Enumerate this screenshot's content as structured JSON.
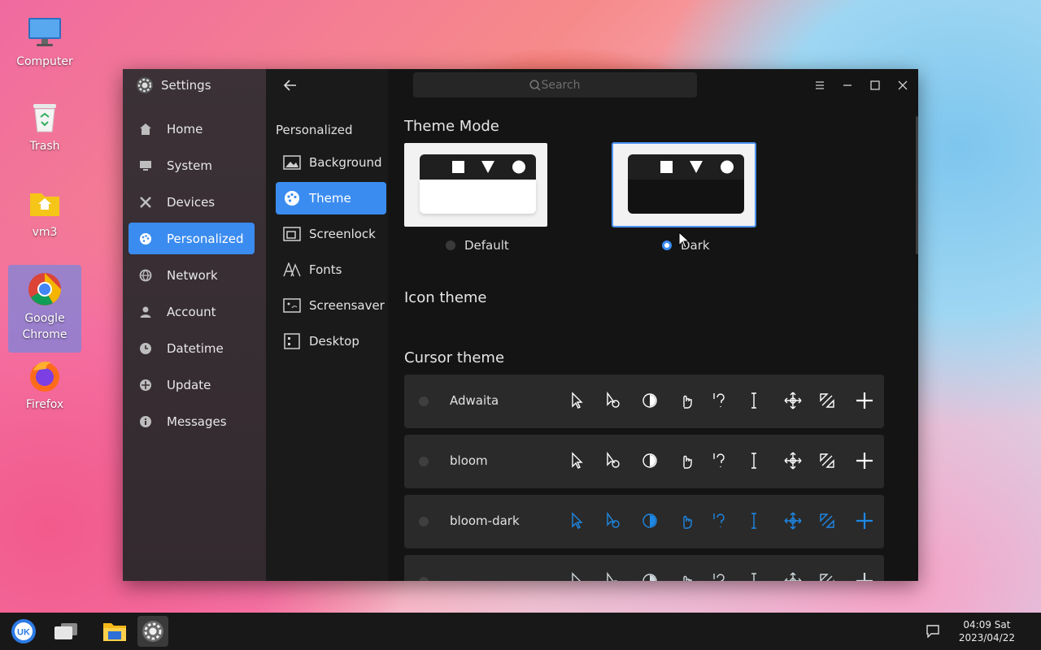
{
  "desktop": {
    "icons": [
      {
        "label": "Computer"
      },
      {
        "label": "Trash"
      },
      {
        "label": "vm3"
      },
      {
        "label": "Google\nChrome"
      },
      {
        "label": "Firefox"
      }
    ]
  },
  "window": {
    "app_title": "Settings",
    "search_placeholder": "Search",
    "sidebar": [
      {
        "label": "Home",
        "icon": "home-icon"
      },
      {
        "label": "System",
        "icon": "monitor-icon"
      },
      {
        "label": "Devices",
        "icon": "tools-icon"
      },
      {
        "label": "Personalized",
        "icon": "palette-icon",
        "active": true
      },
      {
        "label": "Network",
        "icon": "globe-icon"
      },
      {
        "label": "Account",
        "icon": "user-icon"
      },
      {
        "label": "Datetime",
        "icon": "clock-icon"
      },
      {
        "label": "Update",
        "icon": "update-icon"
      },
      {
        "label": "Messages",
        "icon": "info-icon"
      }
    ],
    "subnav": {
      "header": "Personalized",
      "items": [
        {
          "label": "Background",
          "icon": "image-icon"
        },
        {
          "label": "Theme",
          "icon": "palette-icon",
          "active": true
        },
        {
          "label": "Screenlock",
          "icon": "screenlock-icon"
        },
        {
          "label": "Fonts",
          "icon": "font-icon"
        },
        {
          "label": "Screensaver",
          "icon": "screensaver-icon"
        },
        {
          "label": "Desktop",
          "icon": "desktop-grid-icon"
        }
      ]
    },
    "content": {
      "theme_mode_title": "Theme Mode",
      "theme_modes": [
        {
          "label": "Default",
          "selected": false
        },
        {
          "label": "Dark",
          "selected": true
        }
      ],
      "icon_theme_title": "Icon theme",
      "cursor_theme_title": "Cursor theme",
      "cursor_themes": [
        {
          "name": "Adwaita",
          "color": "#ffffff"
        },
        {
          "name": "bloom",
          "color": "#ffffff"
        },
        {
          "name": "bloom-dark",
          "color": "#1e88e5"
        },
        {
          "name": "",
          "color": "#cfd8dc"
        }
      ]
    }
  },
  "taskbar": {
    "items": [
      "start-menu",
      "multitask-view",
      "file-manager",
      "settings"
    ],
    "clock_time": "04:09 Sat",
    "clock_date": "2023/04/22"
  },
  "colors": {
    "accent": "#3b8cf0",
    "window_bg": "#141414",
    "sidebar_bg": "#362d32"
  }
}
